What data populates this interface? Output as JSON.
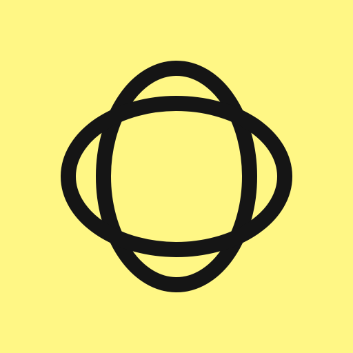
{
  "icon": {
    "semantic": "interlocking-ellipses-logo-icon",
    "background_color": "#FFF785",
    "stroke_color": "#151515"
  }
}
